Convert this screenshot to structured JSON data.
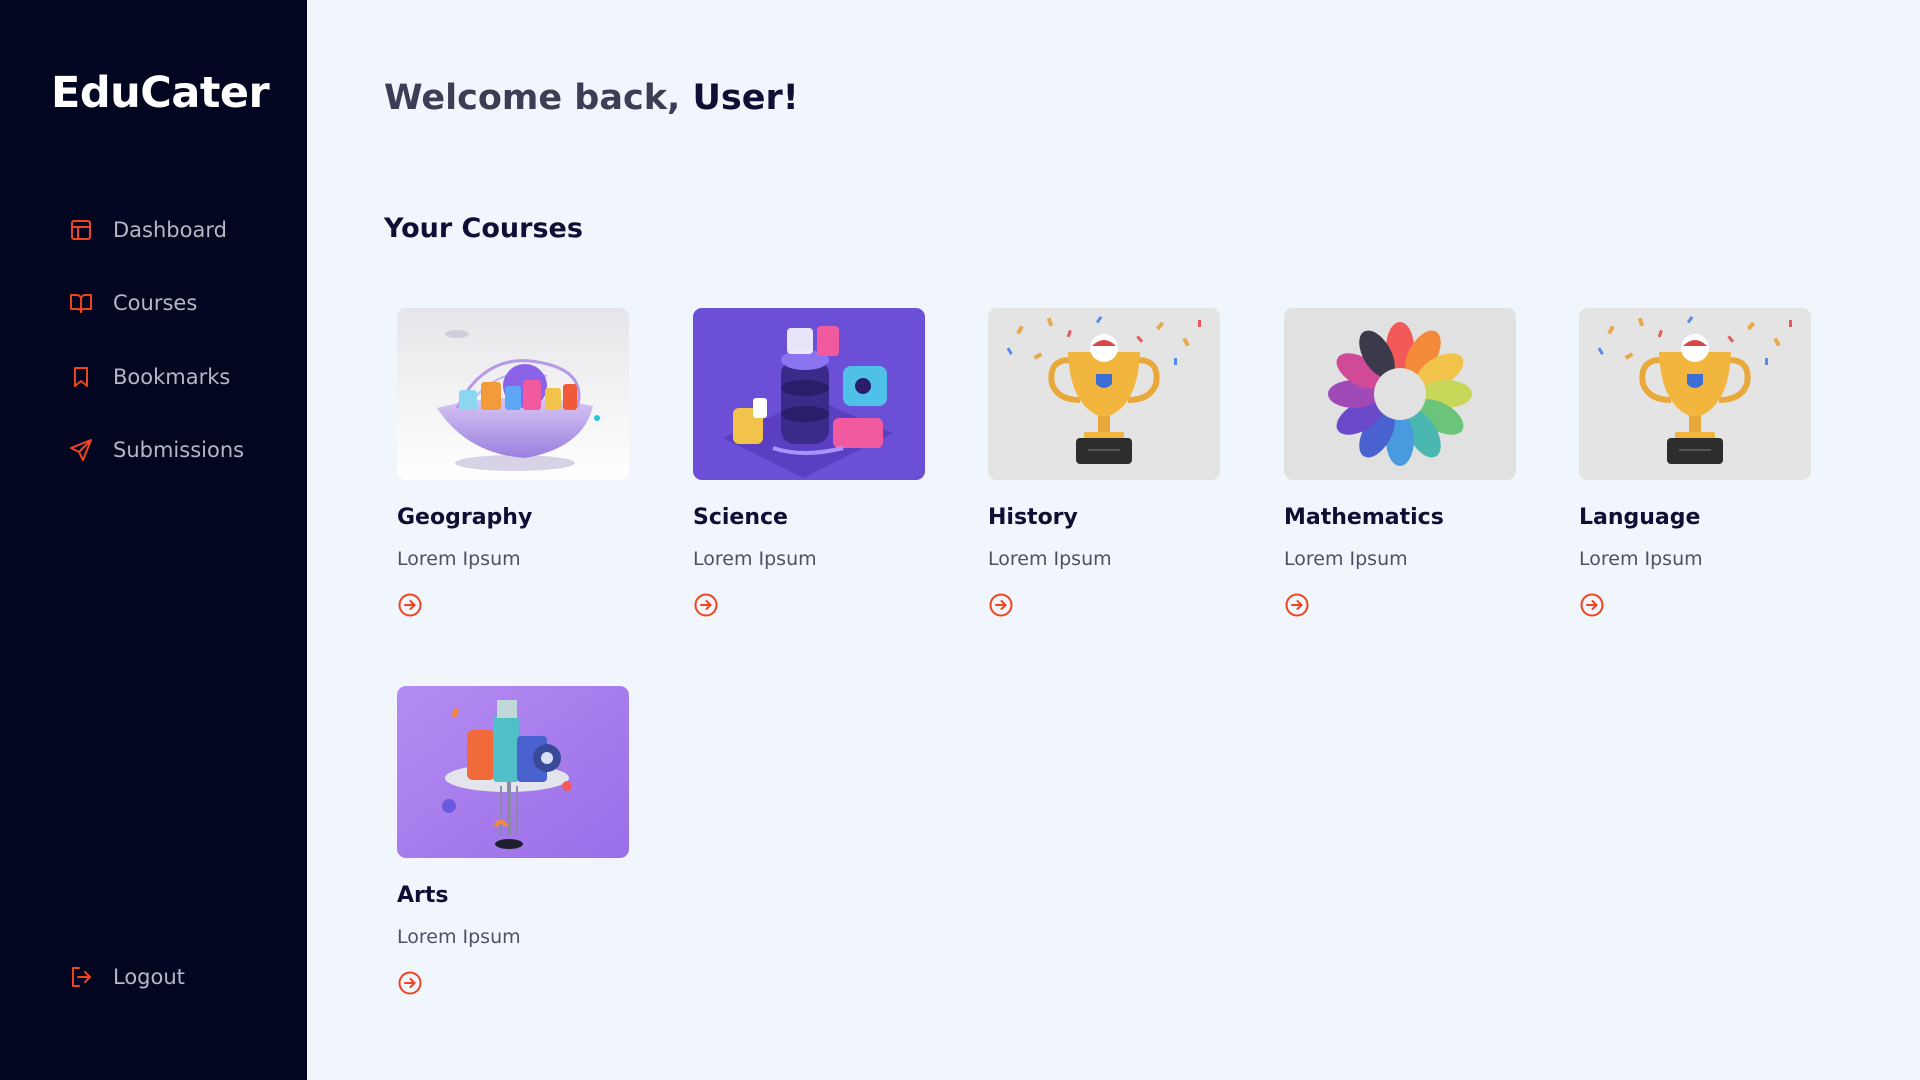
{
  "app": {
    "brand": "EduCater"
  },
  "sidebar": {
    "items": [
      {
        "label": "Dashboard",
        "icon": "dashboard-icon"
      },
      {
        "label": "Courses",
        "icon": "book-icon"
      },
      {
        "label": "Bookmarks",
        "icon": "bookmark-icon"
      },
      {
        "label": "Submissions",
        "icon": "send-icon"
      }
    ],
    "logout": {
      "label": "Logout",
      "icon": "logout-icon"
    }
  },
  "main": {
    "welcome_prefix": "Welcome back, ",
    "welcome_user": "User!",
    "section_title": "Your Courses",
    "courses": [
      {
        "title": "Geography",
        "subtitle": "Lorem Ipsum",
        "image": "floating-island-illustration"
      },
      {
        "title": "Science",
        "subtitle": "Lorem Ipsum",
        "image": "isometric-lab-illustration"
      },
      {
        "title": "History",
        "subtitle": "Lorem Ipsum",
        "image": "trophy-illustration"
      },
      {
        "title": "Mathematics",
        "subtitle": "Lorem Ipsum",
        "image": "color-wheel-illustration"
      },
      {
        "title": "Language",
        "subtitle": "Lorem Ipsum",
        "image": "trophy-illustration"
      },
      {
        "title": "Arts",
        "subtitle": "Lorem Ipsum",
        "image": "abstract-tower-illustration"
      }
    ]
  },
  "colors": {
    "sidebar_bg": "#020620",
    "accent": "#f0441f",
    "page_bg": "#f1f5fc",
    "heading": "#0f0f35"
  }
}
